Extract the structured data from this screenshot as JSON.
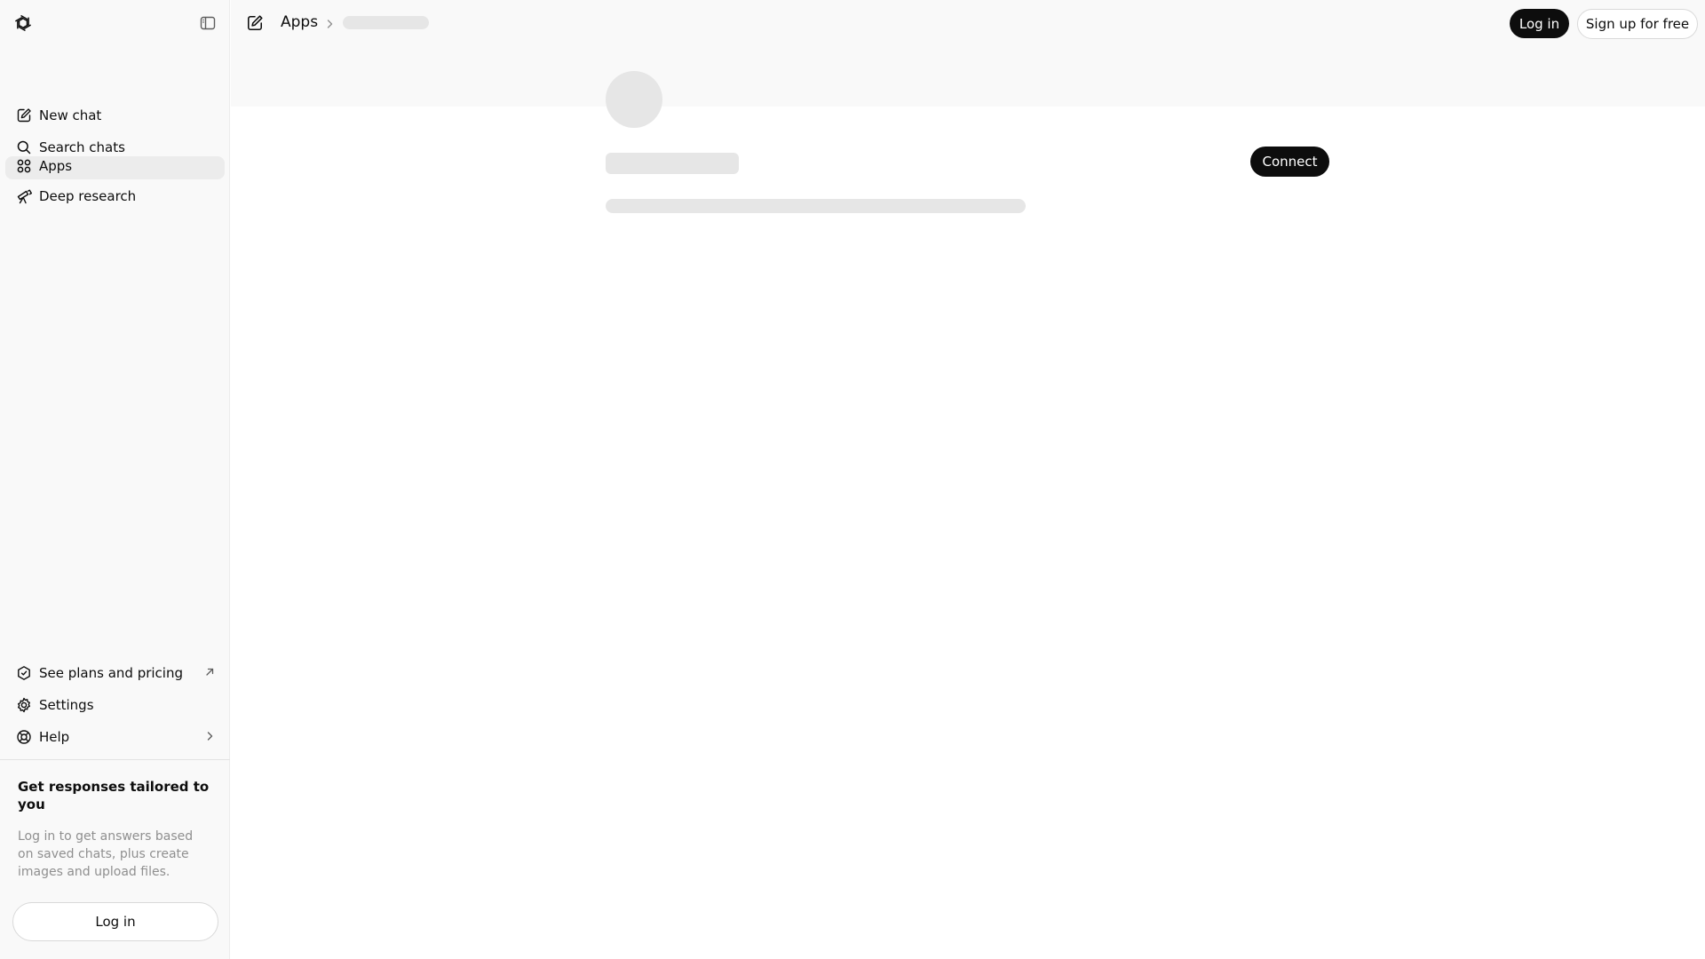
{
  "sidebar": {
    "logo_icon": "openai-logo-icon",
    "toggle_icon": "sidebar-toggle-icon",
    "items": [
      {
        "label": "New chat",
        "icon": "new-chat-icon"
      },
      {
        "label": "Search chats",
        "icon": "search-icon"
      },
      {
        "label": "Apps",
        "icon": "apps-icon",
        "active": true
      },
      {
        "label": "Deep research",
        "icon": "telescope-icon"
      }
    ],
    "footer_items": [
      {
        "label": "See plans and pricing",
        "icon": "plans-icon",
        "trail_icon": "external-arrow-icon"
      },
      {
        "label": "Settings",
        "icon": "gear-icon"
      },
      {
        "label": "Help",
        "icon": "help-icon",
        "trail_icon": "chevron-right-icon"
      }
    ],
    "promo": {
      "title": "Get responses tailored to you",
      "text": "Log in to get answers based on saved chats, plus create images and upload files.",
      "login_label": "Log in"
    }
  },
  "header": {
    "breadcrumb_root": "Apps",
    "login_label": "Log in",
    "signup_label": "Sign up for free"
  },
  "app_detail": {
    "connect_label": "Connect",
    "loading": true
  },
  "colors": {
    "primary_button": "#0d0d0d",
    "sidebar_bg": "#f9f9f9",
    "skeleton": "#e6e6e6",
    "muted_text": "#8f8f8f"
  }
}
